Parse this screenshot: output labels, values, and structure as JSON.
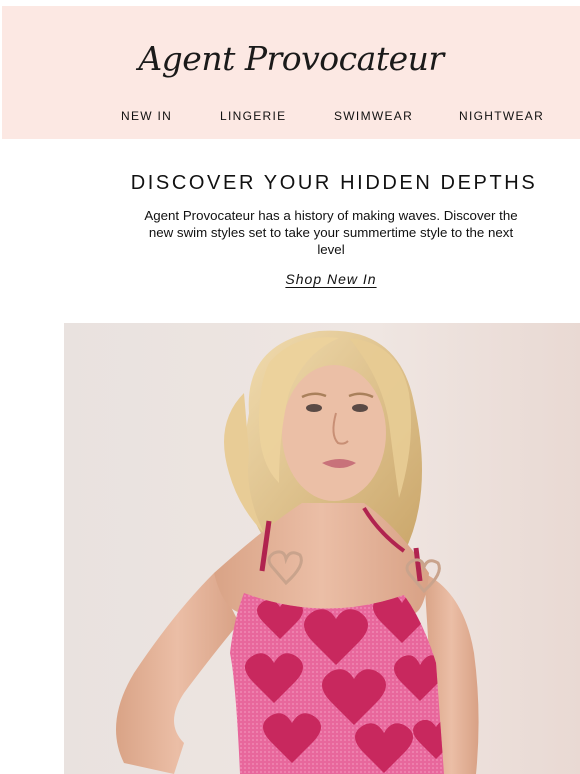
{
  "header": {
    "logo_text": "Agent Provocateur",
    "nav": [
      {
        "label": "NEW IN"
      },
      {
        "label": "LINGERIE"
      },
      {
        "label": "SWIMWEAR"
      },
      {
        "label": "NIGHTWEAR"
      }
    ]
  },
  "hero": {
    "title": "DISCOVER YOUR HIDDEN DEPTHS",
    "body": "Agent Provocateur has a history of making waves. Discover the new swim styles set to take your summertime style to the next level",
    "cta_label": "Shop New In"
  },
  "photo": {
    "subject": "model-in-heart-print-pink-swimsuit",
    "colors": {
      "background": "#ece3df",
      "swimsuit": "#e8639a",
      "hearts": "#c8285e",
      "straps": "#b0244f",
      "skin": "#e7b79e",
      "hair": "#e4c78f"
    }
  },
  "colors": {
    "header_background": "#fce8e3",
    "text": "#111111",
    "page_background": "#ffffff"
  }
}
